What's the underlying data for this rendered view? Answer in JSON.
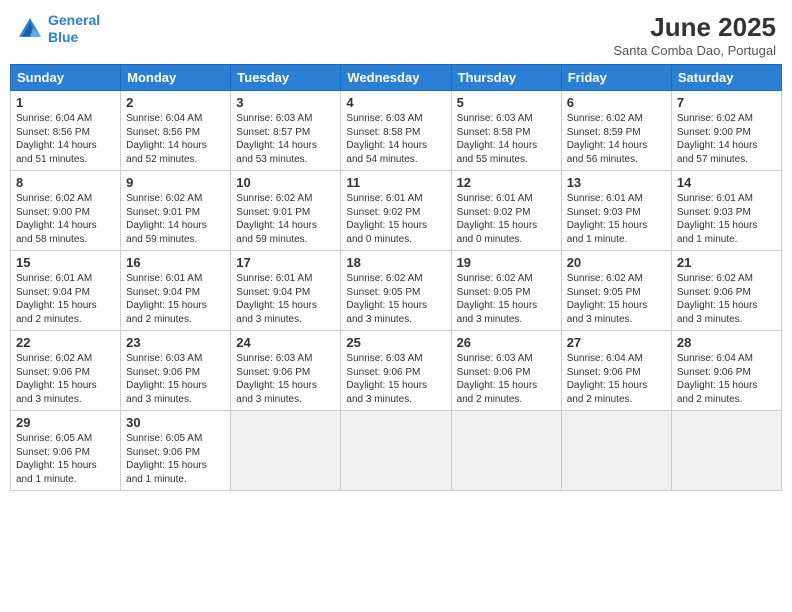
{
  "header": {
    "logo_line1": "General",
    "logo_line2": "Blue",
    "month": "June 2025",
    "location": "Santa Comba Dao, Portugal"
  },
  "days_of_week": [
    "Sunday",
    "Monday",
    "Tuesday",
    "Wednesday",
    "Thursday",
    "Friday",
    "Saturday"
  ],
  "weeks": [
    [
      {
        "day": "1",
        "info": "Sunrise: 6:04 AM\nSunset: 8:56 PM\nDaylight: 14 hours\nand 51 minutes."
      },
      {
        "day": "2",
        "info": "Sunrise: 6:04 AM\nSunset: 8:56 PM\nDaylight: 14 hours\nand 52 minutes."
      },
      {
        "day": "3",
        "info": "Sunrise: 6:03 AM\nSunset: 8:57 PM\nDaylight: 14 hours\nand 53 minutes."
      },
      {
        "day": "4",
        "info": "Sunrise: 6:03 AM\nSunset: 8:58 PM\nDaylight: 14 hours\nand 54 minutes."
      },
      {
        "day": "5",
        "info": "Sunrise: 6:03 AM\nSunset: 8:58 PM\nDaylight: 14 hours\nand 55 minutes."
      },
      {
        "day": "6",
        "info": "Sunrise: 6:02 AM\nSunset: 8:59 PM\nDaylight: 14 hours\nand 56 minutes."
      },
      {
        "day": "7",
        "info": "Sunrise: 6:02 AM\nSunset: 9:00 PM\nDaylight: 14 hours\nand 57 minutes."
      }
    ],
    [
      {
        "day": "8",
        "info": "Sunrise: 6:02 AM\nSunset: 9:00 PM\nDaylight: 14 hours\nand 58 minutes."
      },
      {
        "day": "9",
        "info": "Sunrise: 6:02 AM\nSunset: 9:01 PM\nDaylight: 14 hours\nand 59 minutes."
      },
      {
        "day": "10",
        "info": "Sunrise: 6:02 AM\nSunset: 9:01 PM\nDaylight: 14 hours\nand 59 minutes."
      },
      {
        "day": "11",
        "info": "Sunrise: 6:01 AM\nSunset: 9:02 PM\nDaylight: 15 hours\nand 0 minutes."
      },
      {
        "day": "12",
        "info": "Sunrise: 6:01 AM\nSunset: 9:02 PM\nDaylight: 15 hours\nand 0 minutes."
      },
      {
        "day": "13",
        "info": "Sunrise: 6:01 AM\nSunset: 9:03 PM\nDaylight: 15 hours\nand 1 minute."
      },
      {
        "day": "14",
        "info": "Sunrise: 6:01 AM\nSunset: 9:03 PM\nDaylight: 15 hours\nand 1 minute."
      }
    ],
    [
      {
        "day": "15",
        "info": "Sunrise: 6:01 AM\nSunset: 9:04 PM\nDaylight: 15 hours\nand 2 minutes."
      },
      {
        "day": "16",
        "info": "Sunrise: 6:01 AM\nSunset: 9:04 PM\nDaylight: 15 hours\nand 2 minutes."
      },
      {
        "day": "17",
        "info": "Sunrise: 6:01 AM\nSunset: 9:04 PM\nDaylight: 15 hours\nand 3 minutes."
      },
      {
        "day": "18",
        "info": "Sunrise: 6:02 AM\nSunset: 9:05 PM\nDaylight: 15 hours\nand 3 minutes."
      },
      {
        "day": "19",
        "info": "Sunrise: 6:02 AM\nSunset: 9:05 PM\nDaylight: 15 hours\nand 3 minutes."
      },
      {
        "day": "20",
        "info": "Sunrise: 6:02 AM\nSunset: 9:05 PM\nDaylight: 15 hours\nand 3 minutes."
      },
      {
        "day": "21",
        "info": "Sunrise: 6:02 AM\nSunset: 9:06 PM\nDaylight: 15 hours\nand 3 minutes."
      }
    ],
    [
      {
        "day": "22",
        "info": "Sunrise: 6:02 AM\nSunset: 9:06 PM\nDaylight: 15 hours\nand 3 minutes."
      },
      {
        "day": "23",
        "info": "Sunrise: 6:03 AM\nSunset: 9:06 PM\nDaylight: 15 hours\nand 3 minutes."
      },
      {
        "day": "24",
        "info": "Sunrise: 6:03 AM\nSunset: 9:06 PM\nDaylight: 15 hours\nand 3 minutes."
      },
      {
        "day": "25",
        "info": "Sunrise: 6:03 AM\nSunset: 9:06 PM\nDaylight: 15 hours\nand 3 minutes."
      },
      {
        "day": "26",
        "info": "Sunrise: 6:03 AM\nSunset: 9:06 PM\nDaylight: 15 hours\nand 2 minutes."
      },
      {
        "day": "27",
        "info": "Sunrise: 6:04 AM\nSunset: 9:06 PM\nDaylight: 15 hours\nand 2 minutes."
      },
      {
        "day": "28",
        "info": "Sunrise: 6:04 AM\nSunset: 9:06 PM\nDaylight: 15 hours\nand 2 minutes."
      }
    ],
    [
      {
        "day": "29",
        "info": "Sunrise: 6:05 AM\nSunset: 9:06 PM\nDaylight: 15 hours\nand 1 minute."
      },
      {
        "day": "30",
        "info": "Sunrise: 6:05 AM\nSunset: 9:06 PM\nDaylight: 15 hours\nand 1 minute."
      },
      {
        "day": "",
        "info": ""
      },
      {
        "day": "",
        "info": ""
      },
      {
        "day": "",
        "info": ""
      },
      {
        "day": "",
        "info": ""
      },
      {
        "day": "",
        "info": ""
      }
    ]
  ]
}
